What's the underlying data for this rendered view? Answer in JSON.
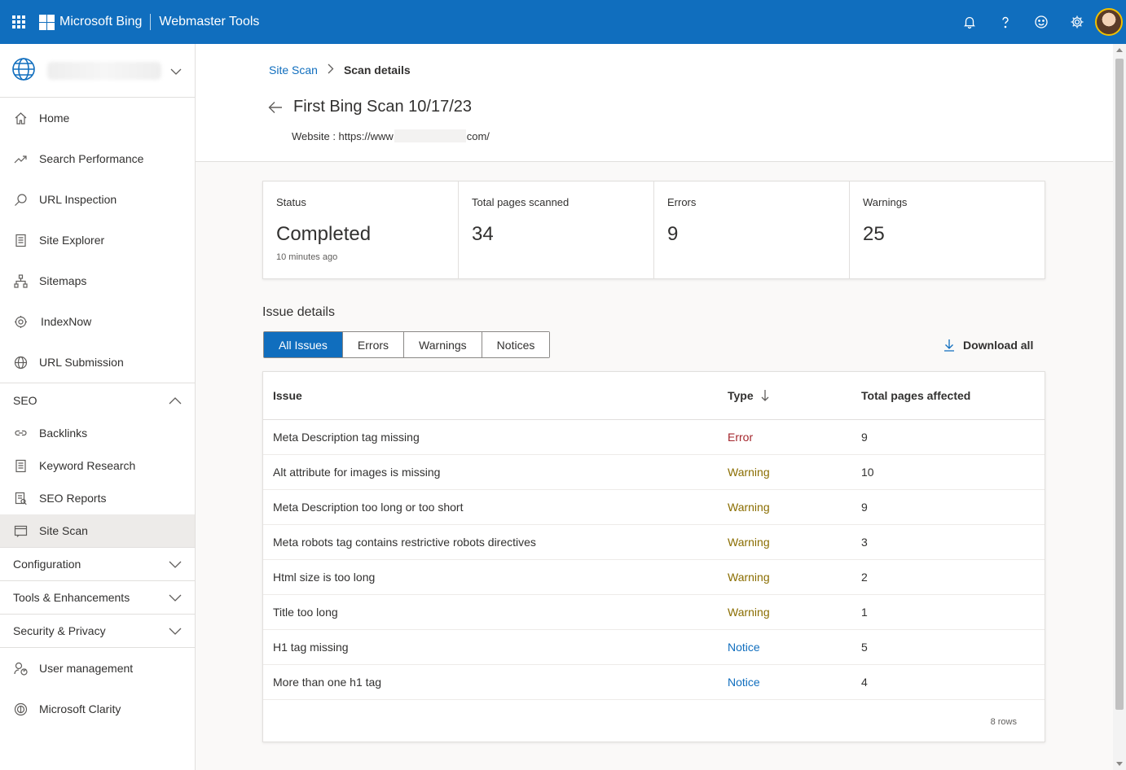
{
  "topbar": {
    "brand": "Microsoft Bing",
    "product": "Webmaster Tools",
    "icons": [
      "waffle-icon",
      "bell-icon",
      "help-icon",
      "feedback-smiley-icon",
      "settings-gear-icon",
      "avatar"
    ]
  },
  "sidebar": {
    "items": [
      {
        "label": "Home",
        "icon": "home-icon"
      },
      {
        "label": "Search Performance",
        "icon": "trend-icon"
      },
      {
        "label": "URL Inspection",
        "icon": "search-icon"
      },
      {
        "label": "Site Explorer",
        "icon": "document-icon"
      },
      {
        "label": "Sitemaps",
        "icon": "sitemap-icon"
      },
      {
        "label": "IndexNow",
        "icon": "gear-icon"
      },
      {
        "label": "URL Submission",
        "icon": "globe-icon"
      }
    ],
    "seo": {
      "label": "SEO",
      "items": [
        {
          "label": "Backlinks",
          "icon": "link-icon"
        },
        {
          "label": "Keyword Research",
          "icon": "document-icon"
        },
        {
          "label": "SEO Reports",
          "icon": "report-icon"
        },
        {
          "label": "Site Scan",
          "icon": "scan-icon",
          "active": true
        }
      ]
    },
    "sections": [
      "Configuration",
      "Tools & Enhancements",
      "Security & Privacy"
    ],
    "bottom": [
      {
        "label": "User management",
        "icon": "user-settings-icon"
      },
      {
        "label": "Microsoft Clarity",
        "icon": "clarity-icon"
      }
    ]
  },
  "breadcrumb": {
    "parent": "Site Scan",
    "current": "Scan details"
  },
  "page": {
    "title": "First Bing Scan 10/17/23",
    "website_prefix": "Website : https://www",
    "website_suffix": "com/"
  },
  "stats": [
    {
      "label": "Status",
      "value": "Completed",
      "sub": "10 minutes ago"
    },
    {
      "label": "Total pages scanned",
      "value": "34"
    },
    {
      "label": "Errors",
      "value": "9"
    },
    {
      "label": "Warnings",
      "value": "25"
    }
  ],
  "issues": {
    "heading": "Issue details",
    "tabs": [
      "All Issues",
      "Errors",
      "Warnings",
      "Notices"
    ],
    "active_tab": "All Issues",
    "download_label": "Download all",
    "columns": [
      "Issue",
      "Type",
      "Total pages affected"
    ],
    "rows": [
      {
        "issue": "Meta Description tag missing",
        "type": "Error",
        "pages": "9"
      },
      {
        "issue": "Alt attribute for images is missing",
        "type": "Warning",
        "pages": "10"
      },
      {
        "issue": "Meta Description too long or too short",
        "type": "Warning",
        "pages": "9"
      },
      {
        "issue": "Meta robots tag contains restrictive robots directives",
        "type": "Warning",
        "pages": "3"
      },
      {
        "issue": "Html size is too long",
        "type": "Warning",
        "pages": "2"
      },
      {
        "issue": "Title too long",
        "type": "Warning",
        "pages": "1"
      },
      {
        "issue": "H1 tag missing",
        "type": "Notice",
        "pages": "5"
      },
      {
        "issue": "More than one h1 tag",
        "type": "Notice",
        "pages": "4"
      }
    ],
    "row_count": "8 rows"
  },
  "colors": {
    "accent": "#106ebe",
    "error": "#a4262c",
    "warning": "#8a6d00",
    "notice": "#106ebe"
  }
}
